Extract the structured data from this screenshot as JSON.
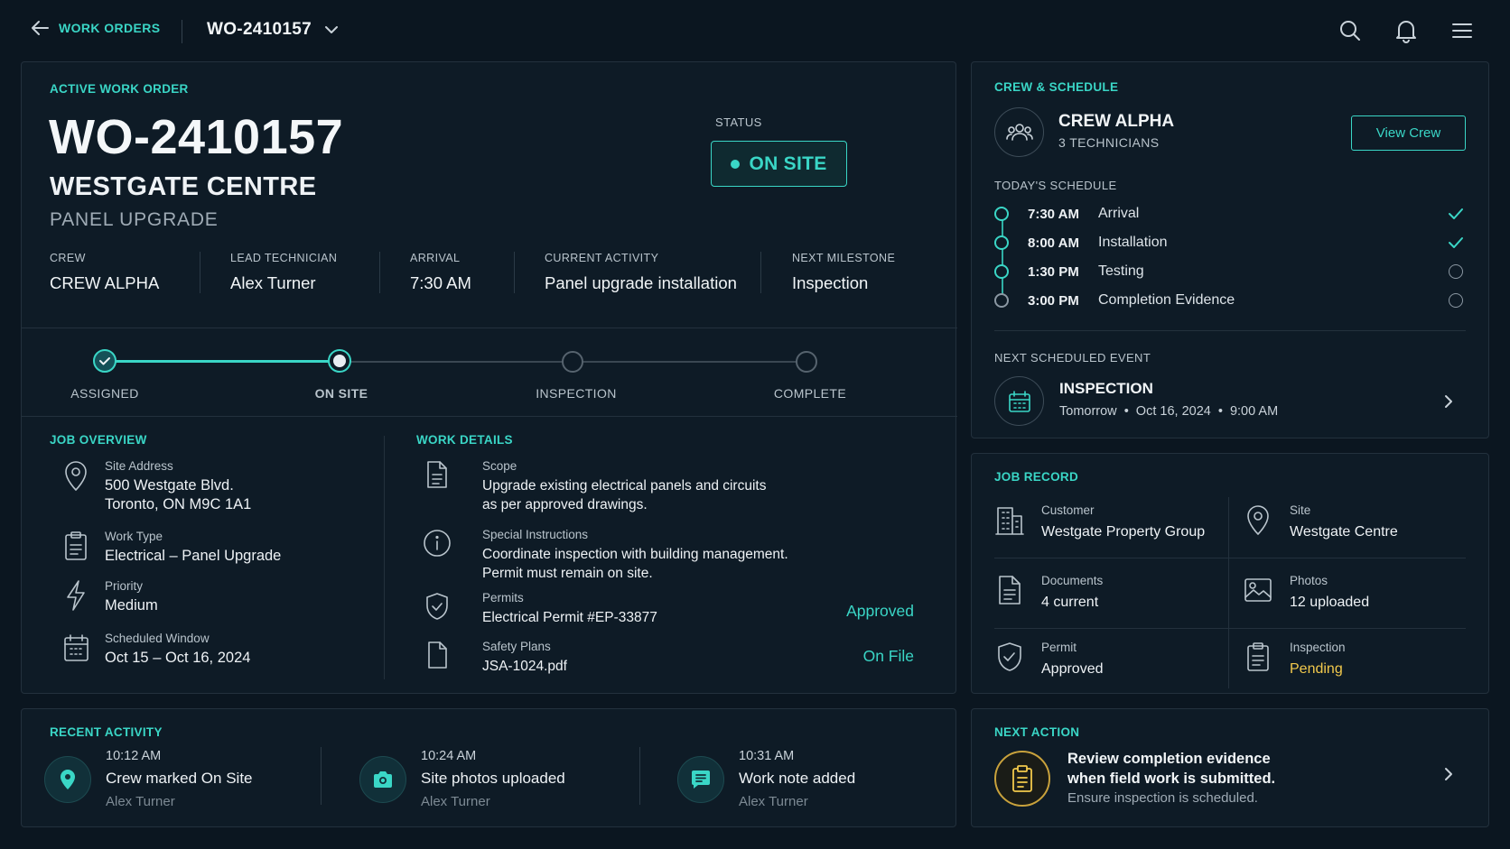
{
  "topbar": {
    "back_label": "WORK ORDERS",
    "work_order_select": "WO-2410157"
  },
  "order": {
    "tag": "ACTIVE WORK ORDER",
    "id": "WO-2410157",
    "site": "WESTGATE CENTRE",
    "job": "PANEL UPGRADE",
    "status_label": "STATUS",
    "status": "ON SITE"
  },
  "facts": [
    {
      "label": "CREW",
      "value": "CREW ALPHA"
    },
    {
      "label": "LEAD TECHNICIAN",
      "value": "Alex Turner"
    },
    {
      "label": "ARRIVAL",
      "value": "7:30 AM"
    },
    {
      "label": "CURRENT ACTIVITY",
      "value": "Panel upgrade installation"
    },
    {
      "label": "NEXT MILESTONE",
      "value": "Inspection"
    }
  ],
  "progress": {
    "steps": [
      "ASSIGNED",
      "ON SITE",
      "INSPECTION",
      "COMPLETE"
    ],
    "completed_fraction": 0.33
  },
  "overview": {
    "title": "JOB OVERVIEW",
    "address_label": "Site Address",
    "address_line1": "500 Westgate Blvd.",
    "address_line2": "Toronto, ON M9C 1A1",
    "worktype_label": "Work Type",
    "worktype": "Electrical – Panel Upgrade",
    "priority_label": "Priority",
    "priority": "Medium",
    "window_label": "Scheduled Window",
    "window": "Oct 15 – Oct 16, 2024"
  },
  "details": {
    "title": "WORK DETAILS",
    "scope_label": "Scope",
    "scope_line1": "Upgrade existing electrical panels and circuits",
    "scope_line2": "as per approved drawings.",
    "instr_label": "Special Instructions",
    "instr_line1": "Coordinate inspection with building management.",
    "instr_line2": "Permit must remain on site.",
    "permits_label": "Permits",
    "permits": "Electrical Permit #EP-33877",
    "permits_status": "Approved",
    "safety_label": "Safety Plans",
    "safety": "JSA-1024.pdf",
    "safety_status": "On File"
  },
  "crew": {
    "title": "CREW & SCHEDULE",
    "name": "CREW ALPHA",
    "count": "3 TECHNICIANS",
    "view_button": "View Crew",
    "schedule_title": "TODAY'S SCHEDULE",
    "schedule": [
      {
        "time": "7:30 AM",
        "activity": "Arrival",
        "done": true
      },
      {
        "time": "8:00 AM",
        "activity": "Installation",
        "done": true
      },
      {
        "time": "1:30 PM",
        "activity": "Testing",
        "done": false
      },
      {
        "time": "3:00 PM",
        "activity": "Completion Evidence",
        "done": false
      }
    ],
    "next_title": "NEXT SCHEDULED EVENT",
    "next_event": "INSPECTION",
    "next_when": "Tomorrow",
    "next_date": "Oct 16, 2024",
    "next_time": "9:00 AM"
  },
  "record": {
    "title": "JOB RECORD",
    "customer_label": "Customer",
    "customer": "Westgate Property Group",
    "site_label": "Site",
    "site": "Westgate Centre",
    "documents_label": "Documents",
    "documents": "4 current",
    "photos_label": "Photos",
    "photos": "12 uploaded",
    "permit_label": "Permit",
    "permit": "Approved",
    "inspection_label": "Inspection",
    "inspection": "Pending"
  },
  "recent": {
    "title": "RECENT ACTIVITY",
    "items": [
      {
        "time": "10:12 AM",
        "message": "Crew marked On Site",
        "who": "Alex Turner"
      },
      {
        "time": "10:24 AM",
        "message": "Site photos uploaded",
        "who": "Alex Turner"
      },
      {
        "time": "10:31 AM",
        "message": "Work note added",
        "who": "Alex Turner"
      }
    ]
  },
  "next_action": {
    "title": "NEXT ACTION",
    "line1": "Review completion evidence",
    "line2": "when field work is submitted.",
    "sub": "Ensure inspection is scheduled."
  },
  "colors": {
    "accent": "#3ad6c6",
    "warning": "#f2c94c",
    "background": "#0b1620",
    "panel": "#0e1b26"
  }
}
